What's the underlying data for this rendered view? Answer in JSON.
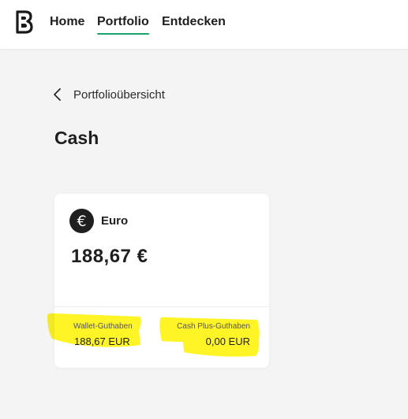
{
  "header": {
    "logo_icon": "bitpanda-b-logo",
    "nav": [
      {
        "label": "Home"
      },
      {
        "label": "Portfolio",
        "active": true
      },
      {
        "label": "Entdecken"
      }
    ],
    "active_color": "#16a56b"
  },
  "breadcrumb": {
    "icon": "chevron-left-icon",
    "label": "Portfolioübersicht"
  },
  "page_title": "Cash",
  "card": {
    "currency_icon": "euro-icon",
    "currency_symbol": "€",
    "currency_name": "Euro",
    "balance": "188,67 €",
    "wallet": {
      "label": "Wallet-Guthaben",
      "value": "188,67 EUR"
    },
    "cash_plus": {
      "label": "Cash Plus-Guthaben",
      "value": "0,00 EUR"
    }
  },
  "highlight_color": "#fff200"
}
